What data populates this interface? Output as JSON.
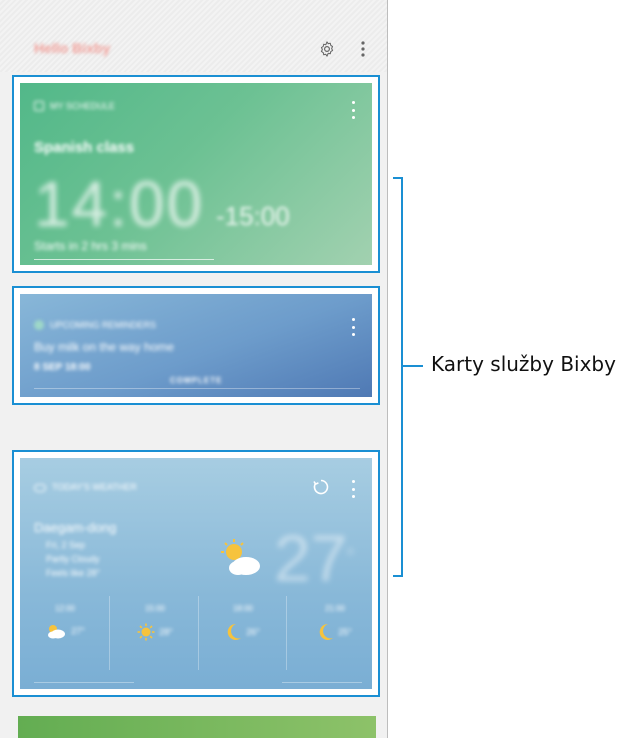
{
  "header": {
    "app_title": "Hello Bixby",
    "settings_icon": "gear-icon",
    "more_icon": "more-vertical-icon"
  },
  "cards": {
    "schedule": {
      "category": "MY SCHEDULE",
      "event": "Spanish class",
      "start": "14:00",
      "end": "-15:00",
      "countdown": "Starts in 2 hrs 3 mins"
    },
    "reminder": {
      "category": "UPCOMING REMINDERS",
      "task": "Buy milk on the way home",
      "time": "8 SEP 18:00",
      "action": "COMPLETE"
    },
    "weather": {
      "category": "TODAY'S WEATHER",
      "location": "Daegam-dong",
      "detail_1": "Fri, 2 Sep",
      "detail_2": "Partly Cloudy",
      "detail_3": "Feels like 28°",
      "temperature": "27",
      "unit": "°",
      "hourly": [
        {
          "time": "12:00",
          "icon": "partly-cloudy-icon",
          "temp": "27°"
        },
        {
          "time": "15:00",
          "icon": "sun-icon",
          "temp": "28°"
        },
        {
          "time": "18:00",
          "icon": "moon-icon",
          "temp": "26°"
        },
        {
          "time": "21:00",
          "icon": "moon-icon",
          "temp": "25°"
        }
      ]
    }
  },
  "callout": {
    "label": "Karty služby Bixby"
  },
  "colors": {
    "highlight": "#1a8fd3",
    "schedule_card": "#5dbb8a",
    "reminder_card": "#6d9ccb",
    "weather_card": "#88b8d8"
  }
}
